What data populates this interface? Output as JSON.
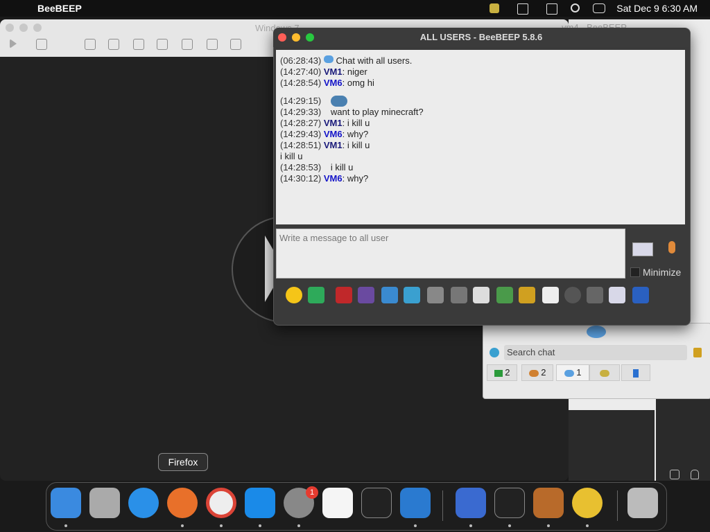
{
  "menubar": {
    "app_name": "BeeBEEP",
    "clock": "Sat Dec 9  6:30 AM"
  },
  "vm_window": {
    "title": "Windows 7"
  },
  "second_window": {
    "title": "vm4 - BeeBEEP"
  },
  "chat_window": {
    "title": "ALL USERS - BeeBEEP 5.8.6",
    "input_placeholder": "Write a message to all user",
    "minimize_label": "Minimize",
    "messages": [
      {
        "ts": "(06:28:43)",
        "user": "",
        "text": " Chat with all users."
      },
      {
        "ts": "(14:27:40)",
        "user": "VM1",
        "text": ": niger"
      },
      {
        "ts": "(14:28:54)",
        "user": "VM6",
        "text": ": omg hi"
      },
      {
        "ts": "(14:29:15)",
        "user": "",
        "text": ""
      },
      {
        "ts": "(14:29:33)",
        "user": "",
        "text": "want to play minecraft?"
      },
      {
        "ts": "(14:28:27)",
        "user": "VM1",
        "text": ": i kill u"
      },
      {
        "ts": "(14:29:43)",
        "user": "VM6",
        "text": ": why?"
      },
      {
        "ts": "(14:28:51)",
        "user": "VM1",
        "text": ": i kill u"
      },
      {
        "ts": "",
        "user": "",
        "text": "i kill u"
      },
      {
        "ts": "(14:28:53)",
        "user": "",
        "text": "i kill u"
      },
      {
        "ts": "(14:30:12)",
        "user": "VM6",
        "text": ": why?"
      }
    ]
  },
  "side_panel": {
    "search_placeholder": "Search chat",
    "tabs": [
      {
        "label": "2",
        "icon": "monitor-icon"
      },
      {
        "label": "2",
        "icon": "users-icon"
      },
      {
        "label": "1",
        "icon": "chat-bubbles-icon"
      },
      {
        "label": "",
        "icon": "group-icon"
      },
      {
        "label": "",
        "icon": "notes-icon"
      }
    ]
  },
  "tooltip": {
    "text": "Firefox"
  },
  "dock": {
    "settings_badge": "1"
  }
}
